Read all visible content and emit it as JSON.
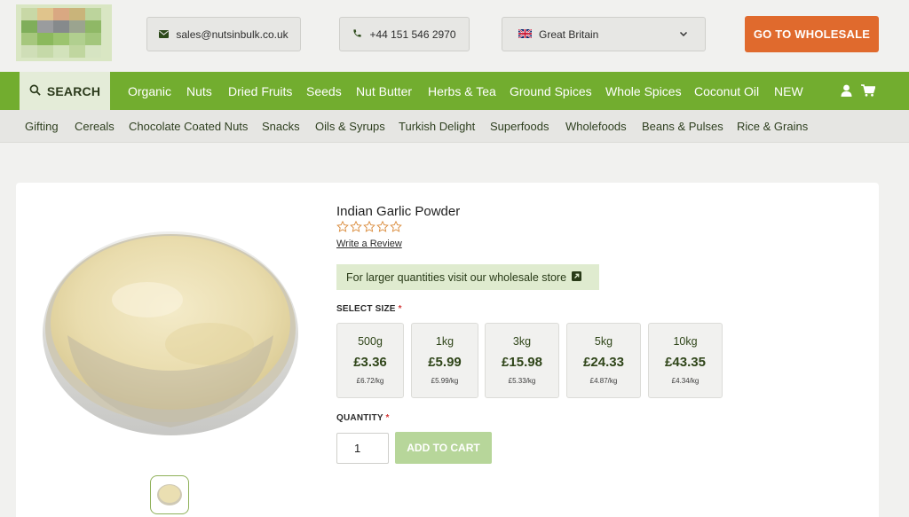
{
  "header": {
    "email": "sales@nutsinbulk.co.uk",
    "phone": "+44 151 546 2970",
    "country": "Great Britain",
    "wholesale_button": "GO TO WHOLESALE"
  },
  "main_nav": {
    "search_label": "SEARCH",
    "items": [
      "Organic",
      "Nuts",
      "Dried Fruits",
      "Seeds",
      "Nut Butter",
      "Herbs & Tea",
      "Ground Spices",
      "Whole Spices",
      "Coconut Oil",
      "NEW"
    ]
  },
  "sub_nav": {
    "items": [
      "Gifting",
      "Cereals",
      "Chocolate Coated Nuts",
      "Snacks",
      "Oils & Syrups",
      "Turkish Delight",
      "Superfoods",
      "Wholefoods",
      "Beans & Pulses",
      "Rice & Grains"
    ]
  },
  "product": {
    "title": "Indian Garlic Powder",
    "rating": 0,
    "rating_max": 5,
    "review_link": "Write a Review",
    "wholesale_note": "For larger quantities visit our wholesale store",
    "size_label": "SELECT SIZE",
    "required_mark": "*",
    "sizes": [
      {
        "weight": "500g",
        "price": "£3.36",
        "per_kg": "£6.72/kg"
      },
      {
        "weight": "1kg",
        "price": "£5.99",
        "per_kg": "£5.99/kg"
      },
      {
        "weight": "3kg",
        "price": "£15.98",
        "per_kg": "£5.33/kg"
      },
      {
        "weight": "5kg",
        "price": "£24.33",
        "per_kg": "£4.87/kg"
      },
      {
        "weight": "10kg",
        "price": "£43.35",
        "per_kg": "£4.34/kg"
      }
    ],
    "quantity_label": "QUANTITY",
    "quantity_value": "1",
    "add_to_cart": "ADD TO CART"
  },
  "colors": {
    "brand_green": "#72ad2f",
    "accent_orange": "#e06a2d",
    "add_to_cart_disabled": "#b7d69a"
  },
  "icons": [
    "envelope-icon",
    "phone-icon",
    "uk-flag-icon",
    "chevron-down-icon",
    "search-icon",
    "user-icon",
    "cart-icon",
    "external-link-icon",
    "star-icon"
  ]
}
